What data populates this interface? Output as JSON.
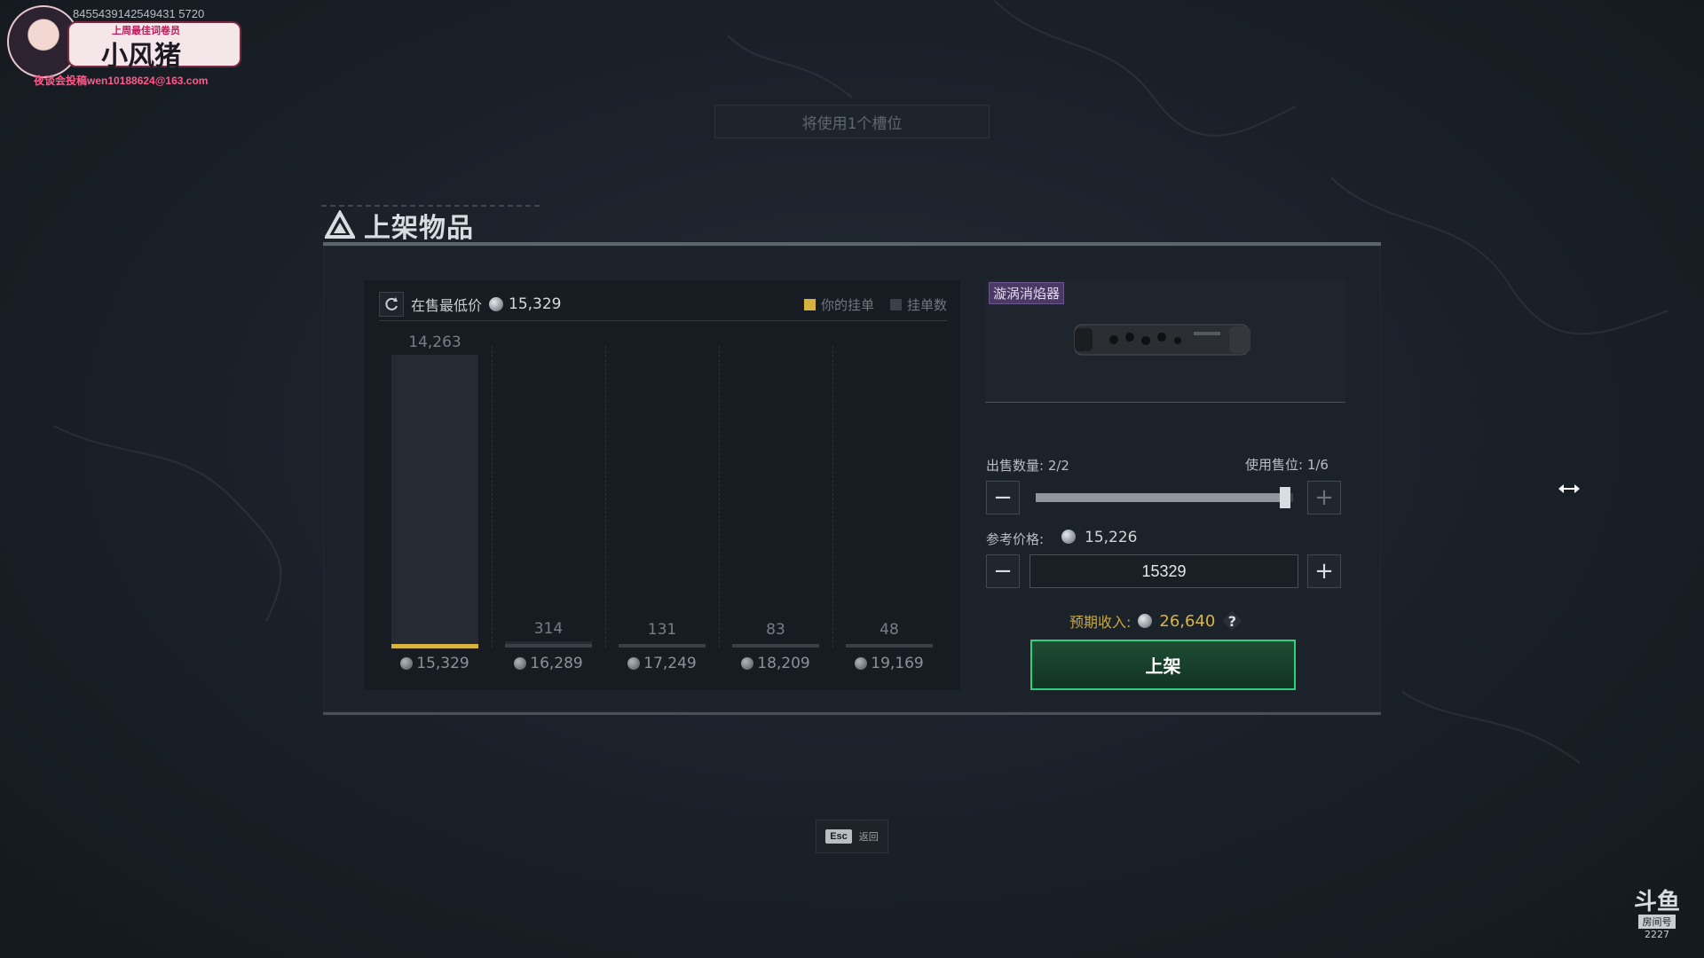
{
  "overlay": {
    "streamer_id": "8455439142549431 5720",
    "streamer_tagline": "上周最佳词卷员",
    "streamer_name": "小风猪",
    "contact": "夜谈会投稿wen10188624@163.com"
  },
  "slot_notice": "将使用1个槽位",
  "panel": {
    "title": "上架物品"
  },
  "chart": {
    "lowest_label": "在售最低价",
    "lowest_price": "15,329",
    "legend_yours": "你的挂单",
    "legend_count": "挂单数"
  },
  "chart_data": {
    "type": "bar",
    "title": "",
    "xlabel": "",
    "ylabel": "",
    "categories": [
      "15,329",
      "16,289",
      "17,249",
      "18,209",
      "19,169"
    ],
    "series": [
      {
        "name": "挂单数",
        "values": [
          14263,
          314,
          131,
          83,
          48
        ]
      }
    ],
    "labels": [
      "14,263",
      "314",
      "131",
      "83",
      "48"
    ],
    "your_listing_category": "15,329",
    "ylim": [
      0,
      14263
    ],
    "grid": false,
    "legend_position": "top-right",
    "colors": {
      "bars": "#252b32",
      "yours": "#d6b23e",
      "count": "#3a4149"
    }
  },
  "item": {
    "name": "漩涡消焰器"
  },
  "quantity": {
    "label": "出售数量: 2/2",
    "slots_label": "使用售位: 1/6",
    "slider_fraction": 0.97,
    "minus": "−",
    "plus": "+"
  },
  "price": {
    "ref_label": "参考价格:",
    "ref_value": "15,226",
    "input_value": "15329",
    "minus": "−",
    "plus": "+"
  },
  "expected": {
    "label": "预期收入:",
    "value": "26,640",
    "help": "?"
  },
  "list_button": "上架",
  "esc": {
    "key": "Esc",
    "label": "返回"
  },
  "douyu": {
    "logo": "斗鱼",
    "room_label": "房间号",
    "room": "2227"
  },
  "colors": {
    "accent_green": "#2fd27a",
    "your_listing_gold": "#d6b23e",
    "item_tag_purple": "#4a3a63"
  }
}
